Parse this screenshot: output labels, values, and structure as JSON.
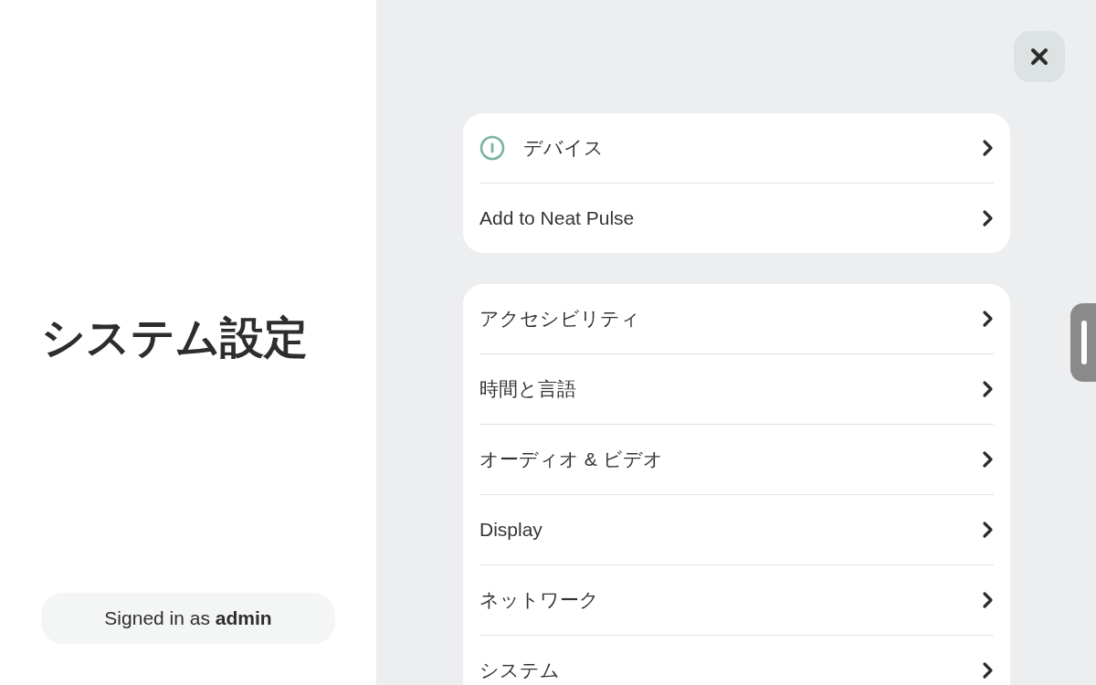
{
  "sidebar": {
    "title": "システム設定",
    "signed_in": "Signed in as **admin**"
  },
  "groups": [
    {
      "items": [
        {
          "kind": "status",
          "label": "デバイス"
        },
        {
          "kind": "plain",
          "label": "Add to Neat Pulse"
        }
      ]
    },
    {
      "items": [
        {
          "kind": "plain",
          "label": "アクセシビリティ"
        },
        {
          "kind": "plain",
          "label": "時間と言語"
        },
        {
          "kind": "plain",
          "label": "オーディオ & ビデオ"
        },
        {
          "kind": "plain",
          "label": "Display"
        },
        {
          "kind": "plain",
          "label": "ネットワーク"
        },
        {
          "kind": "plain",
          "label": "システム"
        }
      ]
    }
  ]
}
